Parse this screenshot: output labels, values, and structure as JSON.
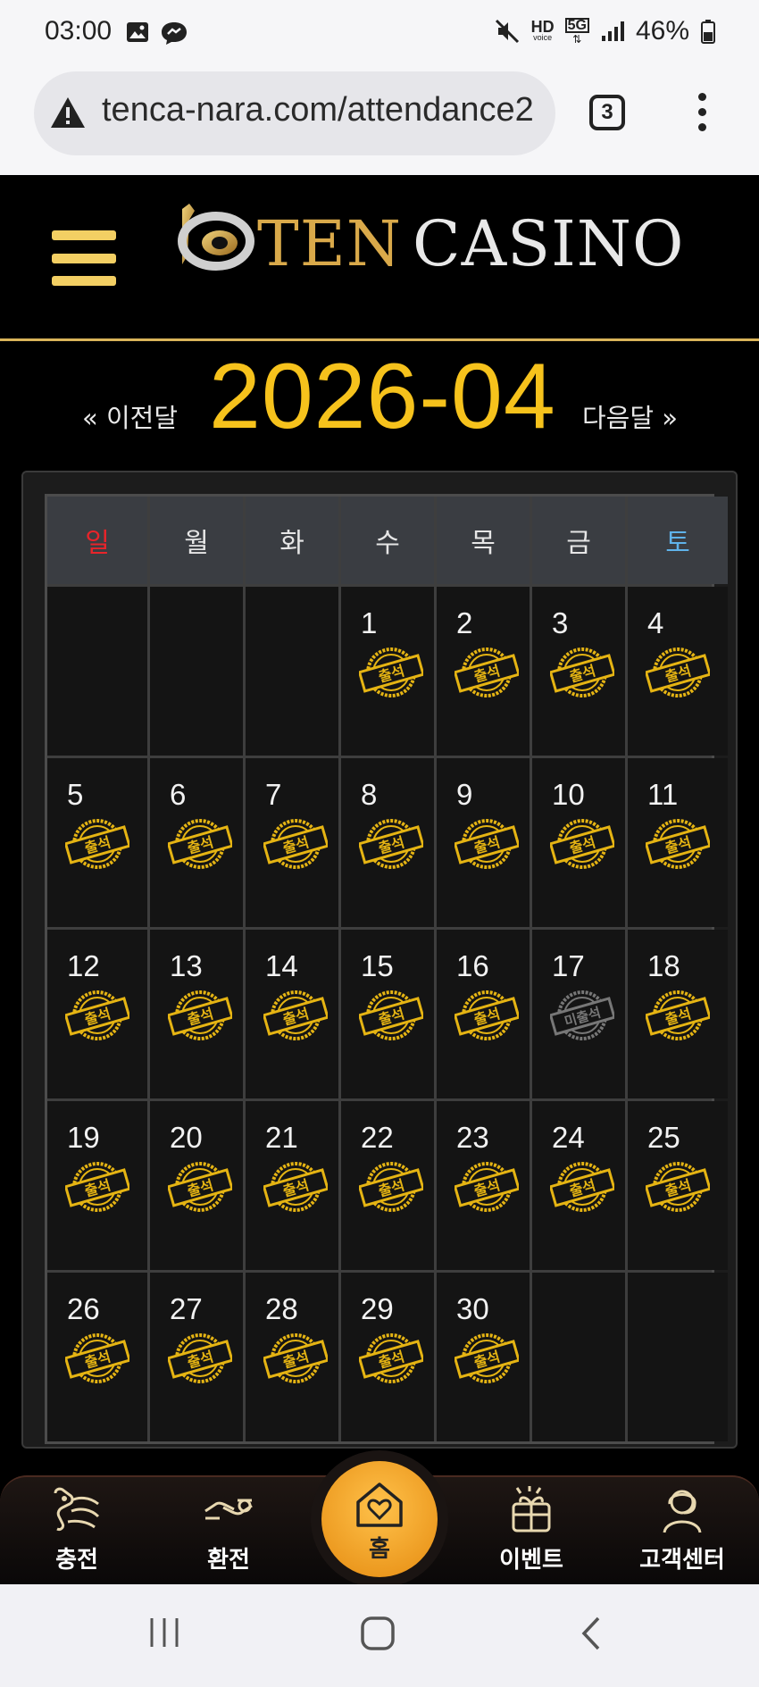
{
  "status": {
    "time": "03:00",
    "network_hd": "HD",
    "network_voice": "voice",
    "network_5g": "5G",
    "battery": "46%"
  },
  "browser": {
    "url": "tenca-nara.com/attendance2",
    "tab_count": "3"
  },
  "header": {
    "logo_ten": "TEN",
    "logo_casino": "CASINO"
  },
  "calendar": {
    "prev_label": "« 이전달",
    "month": "2026-04",
    "next_label": "다음달 »",
    "weekdays": [
      "일",
      "월",
      "화",
      "수",
      "목",
      "금",
      "토"
    ],
    "weeks": [
      [
        "",
        "",
        "",
        "1",
        "2",
        "3",
        "4"
      ],
      [
        "5",
        "6",
        "7",
        "8",
        "9",
        "10",
        "11"
      ],
      [
        "12",
        "13",
        "14",
        "15",
        "16",
        "17",
        "18"
      ],
      [
        "19",
        "20",
        "21",
        "22",
        "23",
        "24",
        "25"
      ],
      [
        "26",
        "27",
        "28",
        "29",
        "30",
        "",
        ""
      ]
    ],
    "stamp_attended": "출석",
    "stamp_missed": "미출석",
    "missed_day": "17",
    "colors": {
      "month_title": "#f6c21c",
      "sunday": "#e8242a",
      "saturday": "#5fb3ea",
      "stamp_gold": "#e5b413",
      "stamp_gray": "#777777"
    }
  },
  "bottom_nav": {
    "items": [
      {
        "label": "충전",
        "icon": "deposit-icon"
      },
      {
        "label": "환전",
        "icon": "exchange-icon"
      },
      {
        "label": "홈",
        "icon": "home-heart-icon"
      },
      {
        "label": "이벤트",
        "icon": "gift-icon"
      },
      {
        "label": "고객센터",
        "icon": "support-icon"
      }
    ]
  }
}
